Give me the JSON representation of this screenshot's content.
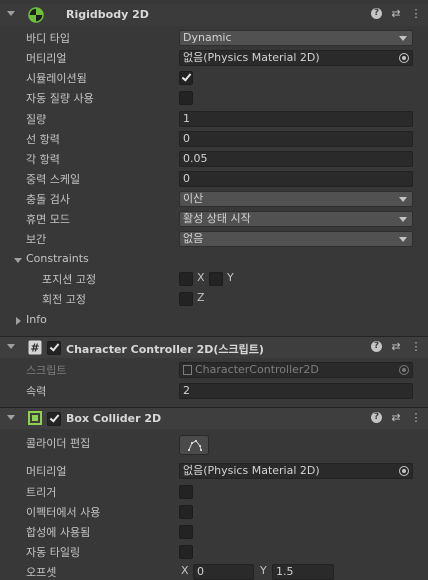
{
  "rigidbody": {
    "title": "Rigidbody 2D",
    "header_icons": {
      "help": "?",
      "preset": "⇄",
      "menu": "⋮"
    },
    "body_type": {
      "label": "바디 타입",
      "value": "Dynamic"
    },
    "material": {
      "label": "머티리얼",
      "value": "없음(Physics Material 2D)"
    },
    "simulated": {
      "label": "시뮬레이션됨",
      "checked": true
    },
    "auto_mass": {
      "label": "자동 질량 사용",
      "checked": false
    },
    "mass": {
      "label": "질량",
      "value": "1"
    },
    "linear_drag": {
      "label": "선 항력",
      "value": "0"
    },
    "angular_drag": {
      "label": "각 항력",
      "value": "0.05"
    },
    "gravity_scale": {
      "label": "중력 스케일",
      "value": "0"
    },
    "collision_detection": {
      "label": "충돌 검사",
      "value": "이산"
    },
    "sleeping_mode": {
      "label": "휴면 모드",
      "value": "활성 상태 시작"
    },
    "interpolate": {
      "label": "보간",
      "value": "없음"
    },
    "constraints": {
      "label": "Constraints",
      "freeze_position": {
        "label": "포지션 고정",
        "x": "X",
        "y": "Y"
      },
      "freeze_rotation": {
        "label": "회전 고정",
        "z": "Z"
      }
    },
    "info": {
      "label": "Info"
    }
  },
  "character_controller": {
    "title": "Character Controller 2D(스크립트)",
    "script": {
      "label": "스크립트",
      "value": "CharacterController2D"
    },
    "speed": {
      "label": "속력",
      "value": "2"
    }
  },
  "box_collider": {
    "title": "Box Collider 2D",
    "edit_collider": {
      "label": "콜라이더 편집"
    },
    "material": {
      "label": "머티리얼",
      "value": "없음(Physics Material 2D)"
    },
    "is_trigger": {
      "label": "트리거"
    },
    "used_by_effector": {
      "label": "이펙터에서 사용"
    },
    "used_by_composite": {
      "label": "합성에 사용됨"
    },
    "auto_tiling": {
      "label": "자동 타일링"
    },
    "offset": {
      "label": "오프셋",
      "x_label": "X",
      "x": "0",
      "y_label": "Y",
      "y": "1.5"
    }
  },
  "colors": {
    "background": "#383838",
    "header": "#3e3e3e",
    "field": "#2a2a2a",
    "dropdown": "#515151",
    "rigidbody_icon": "#6fbf3a",
    "collider_icon": "#8fd14f"
  }
}
